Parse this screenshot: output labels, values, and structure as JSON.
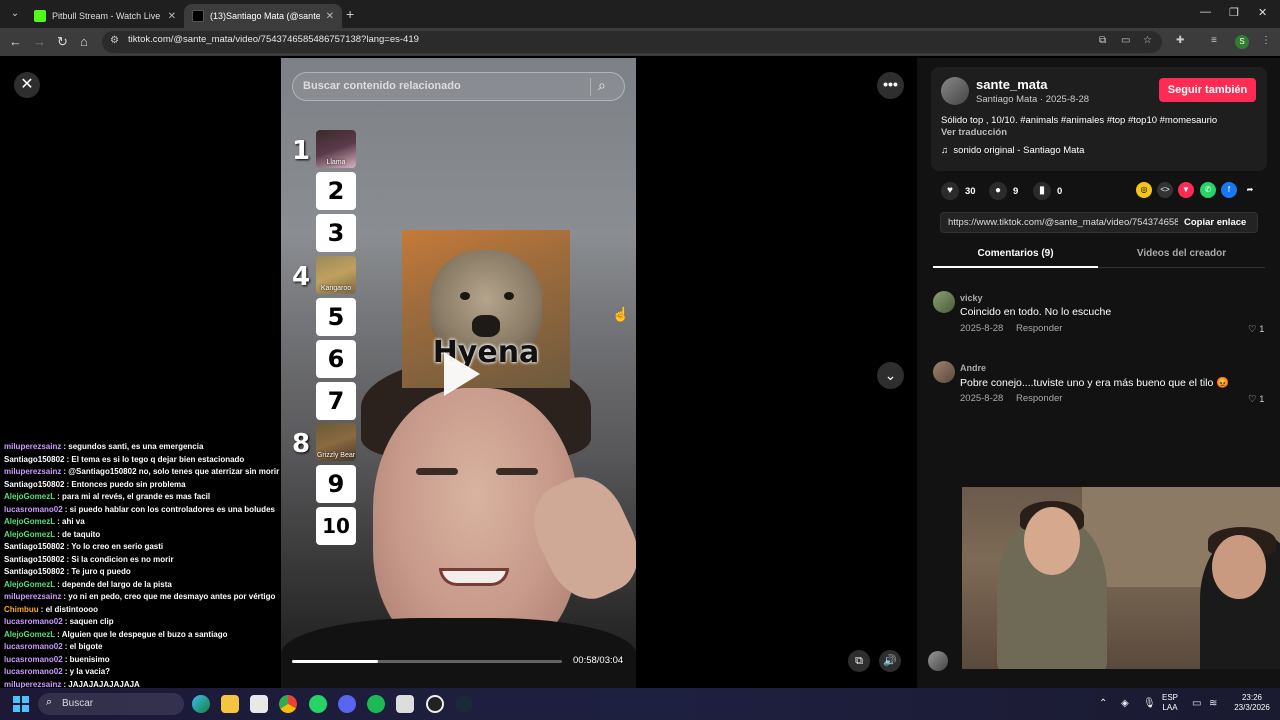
{
  "browser": {
    "tabs": [
      {
        "title": "Pitbull Stream - Watch Live",
        "active": false,
        "favicon_color": "#53fc18"
      },
      {
        "title": "(13)Santiago Mata (@sante_mata)",
        "active": true,
        "favicon_color": "#000000"
      }
    ],
    "url": "tiktok.com/@sante_mata/video/7543746585486757138?lang=es-419",
    "profile_initial": "S"
  },
  "video": {
    "search_placeholder": "Buscar contenido relacionado",
    "ranks": [
      "1",
      "2",
      "3",
      "4",
      "5",
      "6",
      "7",
      "8",
      "9",
      "10"
    ],
    "rank_labels": {
      "r1": "Llama",
      "r4": "Kangaroo",
      "r8": "Grizzly Bear"
    },
    "overlay_word": "Hyena",
    "time": "00:58/03:04",
    "progress": 0.32
  },
  "author": {
    "username": "sante_mata",
    "subline": "Santiago Mata · 2025-8-28",
    "follow_label": "Seguir también",
    "description": "Sólido top , 10/10. #animals #animales #top #top10 #momesaurio",
    "translate_label": "Ver traducción",
    "sound": "sonido original - Santiago Mata"
  },
  "stats": {
    "likes": "30",
    "comments": "9",
    "saves": "0"
  },
  "share": {
    "link": "https://www.tiktok.com/@sante_mata/video/7543746585486757138",
    "copy_label": "Copiar enlace"
  },
  "tabs": {
    "comments": "Comentarios (9)",
    "videos": "Videos del creador"
  },
  "comments": [
    {
      "name": "vicky",
      "text": "Coincido en todo. No lo escuche",
      "date": "2025-8-28",
      "reply": "Responder",
      "likes": "1"
    },
    {
      "name": "Andre",
      "text": "Pobre conejo....tuviste uno y era más bueno que el tilo 😡",
      "date": "2025-8-28",
      "reply": "Responder",
      "likes": "1"
    }
  ],
  "chat": [
    {
      "user": "miluperezsainz",
      "color": "#c99bff",
      "msg": "segundos santi, es una emergencia"
    },
    {
      "user": "Santiago150802",
      "color": "#ffffff",
      "msg": "El tema es si lo tego q dejar bien estacionado"
    },
    {
      "user": "miluperezsainz",
      "color": "#c99bff",
      "msg": "@Santiago150802 no, solo tenes que aterrizar sin morir"
    },
    {
      "user": "Santiago150802",
      "color": "#ffffff",
      "msg": "Entonces puedo sin problema"
    },
    {
      "user": "AlejoGomezL",
      "color": "#53e07a",
      "msg": "para mi al revés, el grande es mas facil"
    },
    {
      "user": "lucasromano02",
      "color": "#c99bff",
      "msg": "si puedo hablar con los controladores es una boludes"
    },
    {
      "user": "AlejoGomezL",
      "color": "#53e07a",
      "msg": "ahi va"
    },
    {
      "user": "AlejoGomezL",
      "color": "#53e07a",
      "msg": "de taquito"
    },
    {
      "user": "Santiago150802",
      "color": "#ffffff",
      "msg": "Yo lo creo en serio gasti"
    },
    {
      "user": "Santiago150802",
      "color": "#ffffff",
      "msg": "Si la condicion es no morir"
    },
    {
      "user": "Santiago150802",
      "color": "#ffffff",
      "msg": "Te juro q puedo"
    },
    {
      "user": "AlejoGomezL",
      "color": "#53e07a",
      "msg": "depende del largo de la pista"
    },
    {
      "user": "miluperezsainz",
      "color": "#c99bff",
      "msg": "yo ni en pedo, creo que me desmayo antes por vértigo"
    },
    {
      "user": "Chimbuu",
      "color": "#ffa726",
      "msg": "el distintoooo"
    },
    {
      "user": "lucasromano02",
      "color": "#c99bff",
      "msg": "saquen clip"
    },
    {
      "user": "AlejoGomezL",
      "color": "#53e07a",
      "msg": "Alguien que le despegue el buzo a santiago"
    },
    {
      "user": "lucasromano02",
      "color": "#c99bff",
      "msg": "el bigote"
    },
    {
      "user": "lucasromano02",
      "color": "#c99bff",
      "msg": "buenisimo"
    },
    {
      "user": "lucasromano02",
      "color": "#c99bff",
      "msg": "y la vacia?"
    },
    {
      "user": "miluperezsainz",
      "color": "#c99bff",
      "msg": "JAJAJAJAJAJAJA"
    }
  ],
  "taskbar": {
    "search_label": "Buscar",
    "lang": "ESP",
    "lang_sub": "LAA",
    "time": "23:26",
    "date": "23/3/2026"
  },
  "colors": {
    "accent": "#fe2c55",
    "panel": "#121212"
  }
}
